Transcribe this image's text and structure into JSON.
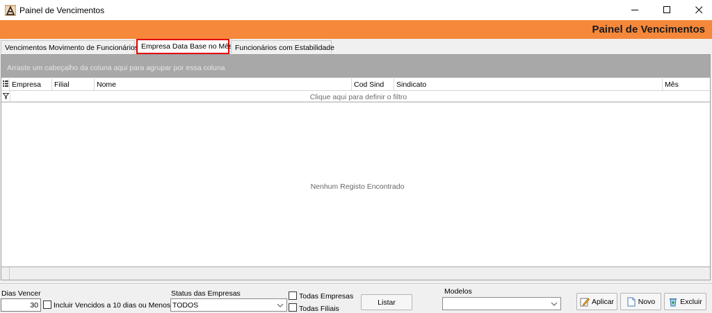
{
  "window": {
    "title": "Painel de Vencimentos",
    "minimize_label": "minimize",
    "maximize_label": "maximize",
    "close_label": "close"
  },
  "banner": {
    "title": "Painel de Vencimentos",
    "color": "#f5883a"
  },
  "tabs": [
    {
      "label": "Vencimentos Movimento de Funcionários",
      "active": false
    },
    {
      "label": "Empresa Data Base no Mês",
      "active": true,
      "highlight_color": "#e20000"
    },
    {
      "label": "Funcionários com Estabilidade",
      "active": false
    }
  ],
  "grid": {
    "group_hint": "Arraste um cabeçalho da coluna aqui para agrupar por essa coluna",
    "columns": [
      "Empresa",
      "Filial",
      "Nome",
      "Cod Sind",
      "Sindicato",
      "Mês"
    ],
    "filter_hint": "Clique aqui para definir o filtro",
    "empty_message": "Nenhum Registo Encontrado",
    "rows": []
  },
  "controls": {
    "dias_vencer_label": "Dias Vencer",
    "dias_vencer_value": "30",
    "incluir_vencidos_label": "Incluir Vencidos a 10 dias ou Menos",
    "incluir_vencidos_checked": false,
    "status_label": "Status das Empresas",
    "status_value": "TODOS",
    "todas_empresas_label": "Todas Empresas",
    "todas_empresas_checked": false,
    "todas_filiais_label": "Todas Filiais",
    "todas_filiais_checked": false,
    "listar_label": "Listar",
    "modelos_label": "Modelos",
    "modelos_value": "",
    "aplicar_label": "Aplicar",
    "novo_label": "Novo",
    "excluir_label": "Excluir"
  }
}
